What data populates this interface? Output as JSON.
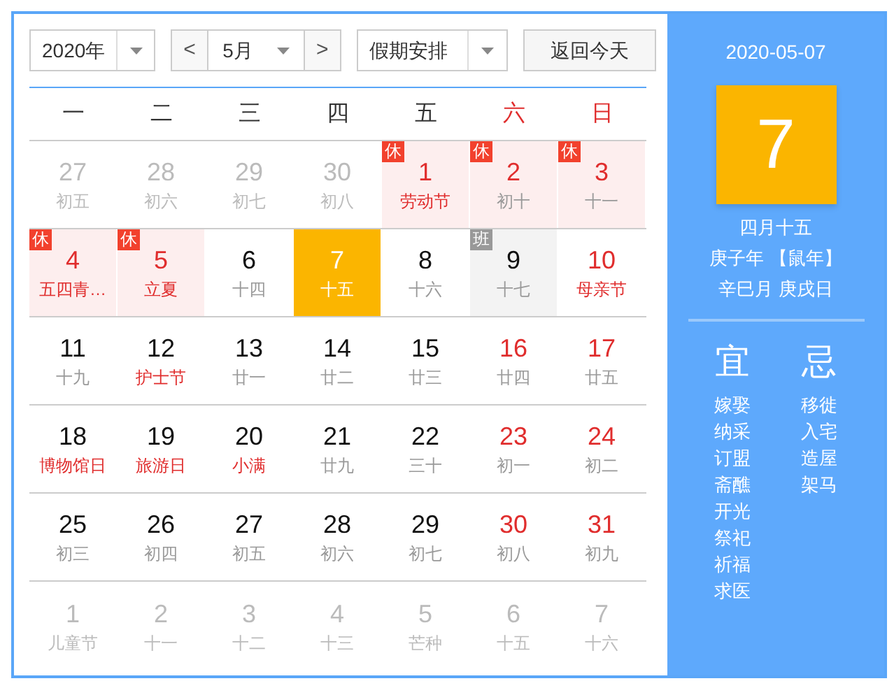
{
  "controls": {
    "year": "2020年",
    "month": "5月",
    "prev": "<",
    "next": ">",
    "holiday": "假期安排",
    "today_button": "返回今天"
  },
  "weekdays": [
    {
      "label": "一",
      "weekend": false
    },
    {
      "label": "二",
      "weekend": false
    },
    {
      "label": "三",
      "weekend": false
    },
    {
      "label": "四",
      "weekend": false
    },
    {
      "label": "五",
      "weekend": false
    },
    {
      "label": "六",
      "weekend": true
    },
    {
      "label": "日",
      "weekend": true
    }
  ],
  "days": [
    {
      "day": "27",
      "lunar": "初五",
      "other_month": true,
      "red": false,
      "festival": false,
      "holiday": false,
      "workday": false,
      "selected": false
    },
    {
      "day": "28",
      "lunar": "初六",
      "other_month": true,
      "red": false,
      "festival": false,
      "holiday": false,
      "workday": false,
      "selected": false
    },
    {
      "day": "29",
      "lunar": "初七",
      "other_month": true,
      "red": false,
      "festival": false,
      "holiday": false,
      "workday": false,
      "selected": false
    },
    {
      "day": "30",
      "lunar": "初八",
      "other_month": true,
      "red": false,
      "festival": false,
      "holiday": false,
      "workday": false,
      "selected": false
    },
    {
      "badge": "休",
      "day": "1",
      "lunar": "劳动节",
      "other_month": false,
      "red": true,
      "festival": true,
      "holiday": true,
      "workday": false,
      "selected": false
    },
    {
      "badge": "休",
      "day": "2",
      "lunar": "初十",
      "other_month": false,
      "red": true,
      "festival": false,
      "holiday": true,
      "workday": false,
      "selected": false
    },
    {
      "badge": "休",
      "day": "3",
      "lunar": "十一",
      "other_month": false,
      "red": true,
      "festival": false,
      "holiday": true,
      "workday": false,
      "selected": false
    },
    {
      "badge": "休",
      "day": "4",
      "lunar": "五四青…",
      "other_month": false,
      "red": true,
      "festival": true,
      "holiday": true,
      "workday": false,
      "selected": false
    },
    {
      "badge": "休",
      "day": "5",
      "lunar": "立夏",
      "other_month": false,
      "red": true,
      "festival": true,
      "holiday": true,
      "workday": false,
      "selected": false
    },
    {
      "day": "6",
      "lunar": "十四",
      "other_month": false,
      "red": false,
      "festival": false,
      "holiday": false,
      "workday": false,
      "selected": false
    },
    {
      "day": "7",
      "lunar": "十五",
      "other_month": false,
      "red": false,
      "festival": false,
      "holiday": false,
      "workday": false,
      "selected": true
    },
    {
      "day": "8",
      "lunar": "十六",
      "other_month": false,
      "red": false,
      "festival": false,
      "holiday": false,
      "workday": false,
      "selected": false
    },
    {
      "badge": "班",
      "day": "9",
      "lunar": "十七",
      "other_month": false,
      "red": false,
      "festival": false,
      "holiday": false,
      "workday": true,
      "selected": false
    },
    {
      "day": "10",
      "lunar": "母亲节",
      "other_month": false,
      "red": true,
      "festival": true,
      "holiday": false,
      "workday": false,
      "selected": false
    },
    {
      "day": "11",
      "lunar": "十九",
      "other_month": false,
      "red": false,
      "festival": false,
      "holiday": false,
      "workday": false,
      "selected": false
    },
    {
      "day": "12",
      "lunar": "护士节",
      "other_month": false,
      "red": false,
      "festival": true,
      "holiday": false,
      "workday": false,
      "selected": false
    },
    {
      "day": "13",
      "lunar": "廿一",
      "other_month": false,
      "red": false,
      "festival": false,
      "holiday": false,
      "workday": false,
      "selected": false
    },
    {
      "day": "14",
      "lunar": "廿二",
      "other_month": false,
      "red": false,
      "festival": false,
      "holiday": false,
      "workday": false,
      "selected": false
    },
    {
      "day": "15",
      "lunar": "廿三",
      "other_month": false,
      "red": false,
      "festival": false,
      "holiday": false,
      "workday": false,
      "selected": false
    },
    {
      "day": "16",
      "lunar": "廿四",
      "other_month": false,
      "red": true,
      "festival": false,
      "holiday": false,
      "workday": false,
      "selected": false
    },
    {
      "day": "17",
      "lunar": "廿五",
      "other_month": false,
      "red": true,
      "festival": false,
      "holiday": false,
      "workday": false,
      "selected": false
    },
    {
      "day": "18",
      "lunar": "博物馆日",
      "other_month": false,
      "red": false,
      "festival": true,
      "holiday": false,
      "workday": false,
      "selected": false
    },
    {
      "day": "19",
      "lunar": "旅游日",
      "other_month": false,
      "red": false,
      "festival": true,
      "holiday": false,
      "workday": false,
      "selected": false
    },
    {
      "day": "20",
      "lunar": "小满",
      "other_month": false,
      "red": false,
      "festival": true,
      "holiday": false,
      "workday": false,
      "selected": false
    },
    {
      "day": "21",
      "lunar": "廿九",
      "other_month": false,
      "red": false,
      "festival": false,
      "holiday": false,
      "workday": false,
      "selected": false
    },
    {
      "day": "22",
      "lunar": "三十",
      "other_month": false,
      "red": false,
      "festival": false,
      "holiday": false,
      "workday": false,
      "selected": false
    },
    {
      "day": "23",
      "lunar": "初一",
      "other_month": false,
      "red": true,
      "festival": false,
      "holiday": false,
      "workday": false,
      "selected": false
    },
    {
      "day": "24",
      "lunar": "初二",
      "other_month": false,
      "red": true,
      "festival": false,
      "holiday": false,
      "workday": false,
      "selected": false
    },
    {
      "day": "25",
      "lunar": "初三",
      "other_month": false,
      "red": false,
      "festival": false,
      "holiday": false,
      "workday": false,
      "selected": false
    },
    {
      "day": "26",
      "lunar": "初四",
      "other_month": false,
      "red": false,
      "festival": false,
      "holiday": false,
      "workday": false,
      "selected": false
    },
    {
      "day": "27",
      "lunar": "初五",
      "other_month": false,
      "red": false,
      "festival": false,
      "holiday": false,
      "workday": false,
      "selected": false
    },
    {
      "day": "28",
      "lunar": "初六",
      "other_month": false,
      "red": false,
      "festival": false,
      "holiday": false,
      "workday": false,
      "selected": false
    },
    {
      "day": "29",
      "lunar": "初七",
      "other_month": false,
      "red": false,
      "festival": false,
      "holiday": false,
      "workday": false,
      "selected": false
    },
    {
      "day": "30",
      "lunar": "初八",
      "other_month": false,
      "red": true,
      "festival": false,
      "holiday": false,
      "workday": false,
      "selected": false
    },
    {
      "day": "31",
      "lunar": "初九",
      "other_month": false,
      "red": true,
      "festival": false,
      "holiday": false,
      "workday": false,
      "selected": false
    },
    {
      "day": "1",
      "lunar": "儿童节",
      "other_month": true,
      "red": false,
      "festival": false,
      "holiday": false,
      "workday": false,
      "selected": false
    },
    {
      "day": "2",
      "lunar": "十一",
      "other_month": true,
      "red": false,
      "festival": false,
      "holiday": false,
      "workday": false,
      "selected": false
    },
    {
      "day": "3",
      "lunar": "十二",
      "other_month": true,
      "red": false,
      "festival": false,
      "holiday": false,
      "workday": false,
      "selected": false
    },
    {
      "day": "4",
      "lunar": "十三",
      "other_month": true,
      "red": false,
      "festival": false,
      "holiday": false,
      "workday": false,
      "selected": false
    },
    {
      "day": "5",
      "lunar": "芒种",
      "other_month": true,
      "red": false,
      "festival": false,
      "holiday": false,
      "workday": false,
      "selected": false
    },
    {
      "day": "6",
      "lunar": "十五",
      "other_month": true,
      "red": false,
      "festival": false,
      "holiday": false,
      "workday": false,
      "selected": false
    },
    {
      "day": "7",
      "lunar": "十六",
      "other_month": true,
      "red": false,
      "festival": false,
      "holiday": false,
      "workday": false,
      "selected": false
    }
  ],
  "detail": {
    "date": "2020-05-07",
    "day": "7",
    "lunar_date": "四月十五",
    "year_line": "庚子年 【鼠年】",
    "month_day_line": "辛巳月 庚戌日",
    "good": {
      "heading": "宜",
      "items": [
        "嫁娶",
        "纳采",
        "订盟",
        "斋醮",
        "开光",
        "祭祀",
        "祈福",
        "求医"
      ]
    },
    "bad": {
      "heading": "忌",
      "items": [
        "移徙",
        "入宅",
        "造屋",
        "架马"
      ]
    }
  }
}
